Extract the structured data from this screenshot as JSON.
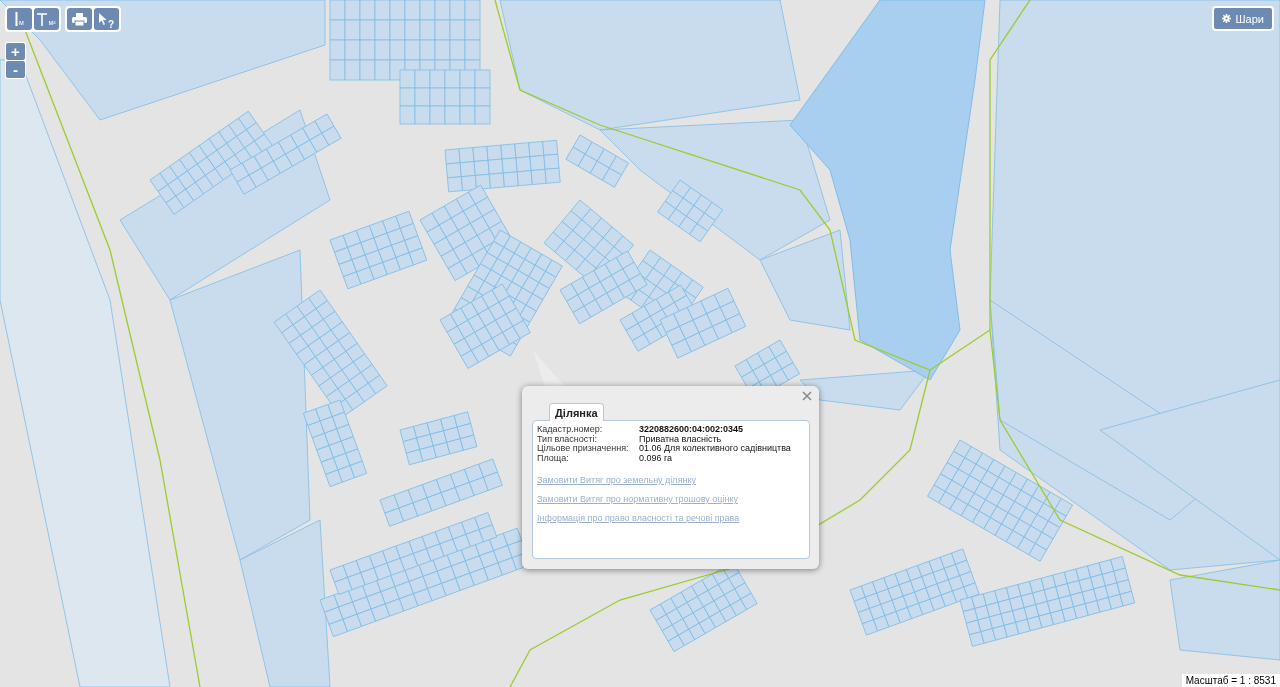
{
  "toolbar": {
    "tools": [
      {
        "kind": "distance",
        "label": "м"
      },
      {
        "kind": "area",
        "label": "м²"
      },
      {
        "kind": "print"
      },
      {
        "kind": "identify",
        "label": "?"
      }
    ]
  },
  "zoom": {
    "in": "+",
    "out": "-"
  },
  "layers_button": {
    "label": "Шари"
  },
  "popup": {
    "tabs": [
      {
        "label": "Ділянка",
        "selected": true
      }
    ],
    "fields": [
      {
        "label": "Кадастр.номер:",
        "value": "3220882600:04:002:0345",
        "emphasis": true
      },
      {
        "label": "Тип власності:",
        "value": "Приватна власність",
        "emphasis": false
      },
      {
        "label": "Цільове призначення:",
        "value": "01.06 Для колективного садівництва",
        "emphasis": false
      },
      {
        "label": "Площа:",
        "value": "0.096 га",
        "emphasis": false
      }
    ],
    "links": [
      "Замовити Витяг про земельну ділянку",
      "Замовити Витяг про нормативну грошову оцінку",
      "Інформація про право власності та речові права"
    ]
  },
  "scale": "Масштаб = 1 : 8531"
}
